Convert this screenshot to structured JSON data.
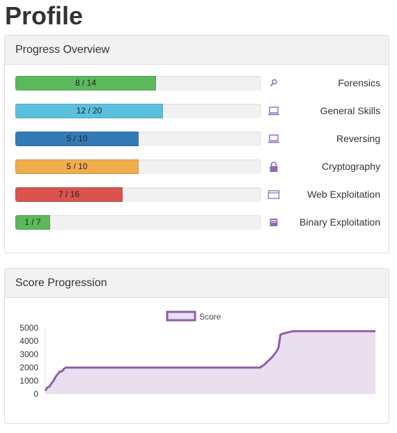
{
  "page": {
    "title": "Profile"
  },
  "progress_overview": {
    "title": "Progress Overview",
    "rows": [
      {
        "label": "Forensics",
        "text": "8 / 14",
        "solved": 8,
        "total": 14,
        "color": "#5cb85c",
        "icon": "search-icon"
      },
      {
        "label": "General Skills",
        "text": "12 / 20",
        "solved": 12,
        "total": 20,
        "color": "#5bc0de",
        "icon": "laptop-icon"
      },
      {
        "label": "Reversing",
        "text": "5 / 10",
        "solved": 5,
        "total": 10,
        "color": "#337ab7",
        "icon": "laptop-icon"
      },
      {
        "label": "Cryptography",
        "text": "5 / 10",
        "solved": 5,
        "total": 10,
        "color": "#f0ad4e",
        "icon": "lock-icon"
      },
      {
        "label": "Web Exploitation",
        "text": "7 / 16",
        "solved": 7,
        "total": 16,
        "color": "#d9534f",
        "icon": "browser-window-icon"
      },
      {
        "label": "Binary Exploitation",
        "text": "1 / 7",
        "solved": 1,
        "total": 7,
        "color": "#5cb85c",
        "icon": "binary-chip-icon"
      }
    ],
    "icon_color": "#8e6bb3"
  },
  "score_progression": {
    "title": "Score Progression"
  },
  "chart_data": {
    "type": "area",
    "title": "",
    "xlabel": "",
    "ylabel": "",
    "ylim": [
      0,
      5000
    ],
    "yticks": [
      0,
      1000,
      2000,
      3000,
      4000,
      5000
    ],
    "legend": {
      "position": "top-center",
      "entries": [
        "Score"
      ]
    },
    "grid": false,
    "series": [
      {
        "name": "Score",
        "line_color": "#8e5ea8",
        "fill_color": "#e9dfee",
        "x": [
          0,
          0.5,
          1,
          1.5,
          2,
          2.5,
          3,
          3.5,
          4,
          4.5,
          5,
          5.5,
          6,
          7,
          8,
          10,
          12,
          52,
          53,
          54,
          55,
          55.5,
          56,
          56.5,
          57,
          58,
          60,
          80
        ],
        "values": [
          250,
          500,
          550,
          800,
          1000,
          1300,
          1500,
          1700,
          1700,
          1900,
          2000,
          2000,
          2000,
          2000,
          2000,
          2000,
          2000,
          2000,
          2200,
          2500,
          2800,
          3000,
          3200,
          3500,
          4500,
          4600,
          4750,
          4750
        ]
      }
    ]
  }
}
